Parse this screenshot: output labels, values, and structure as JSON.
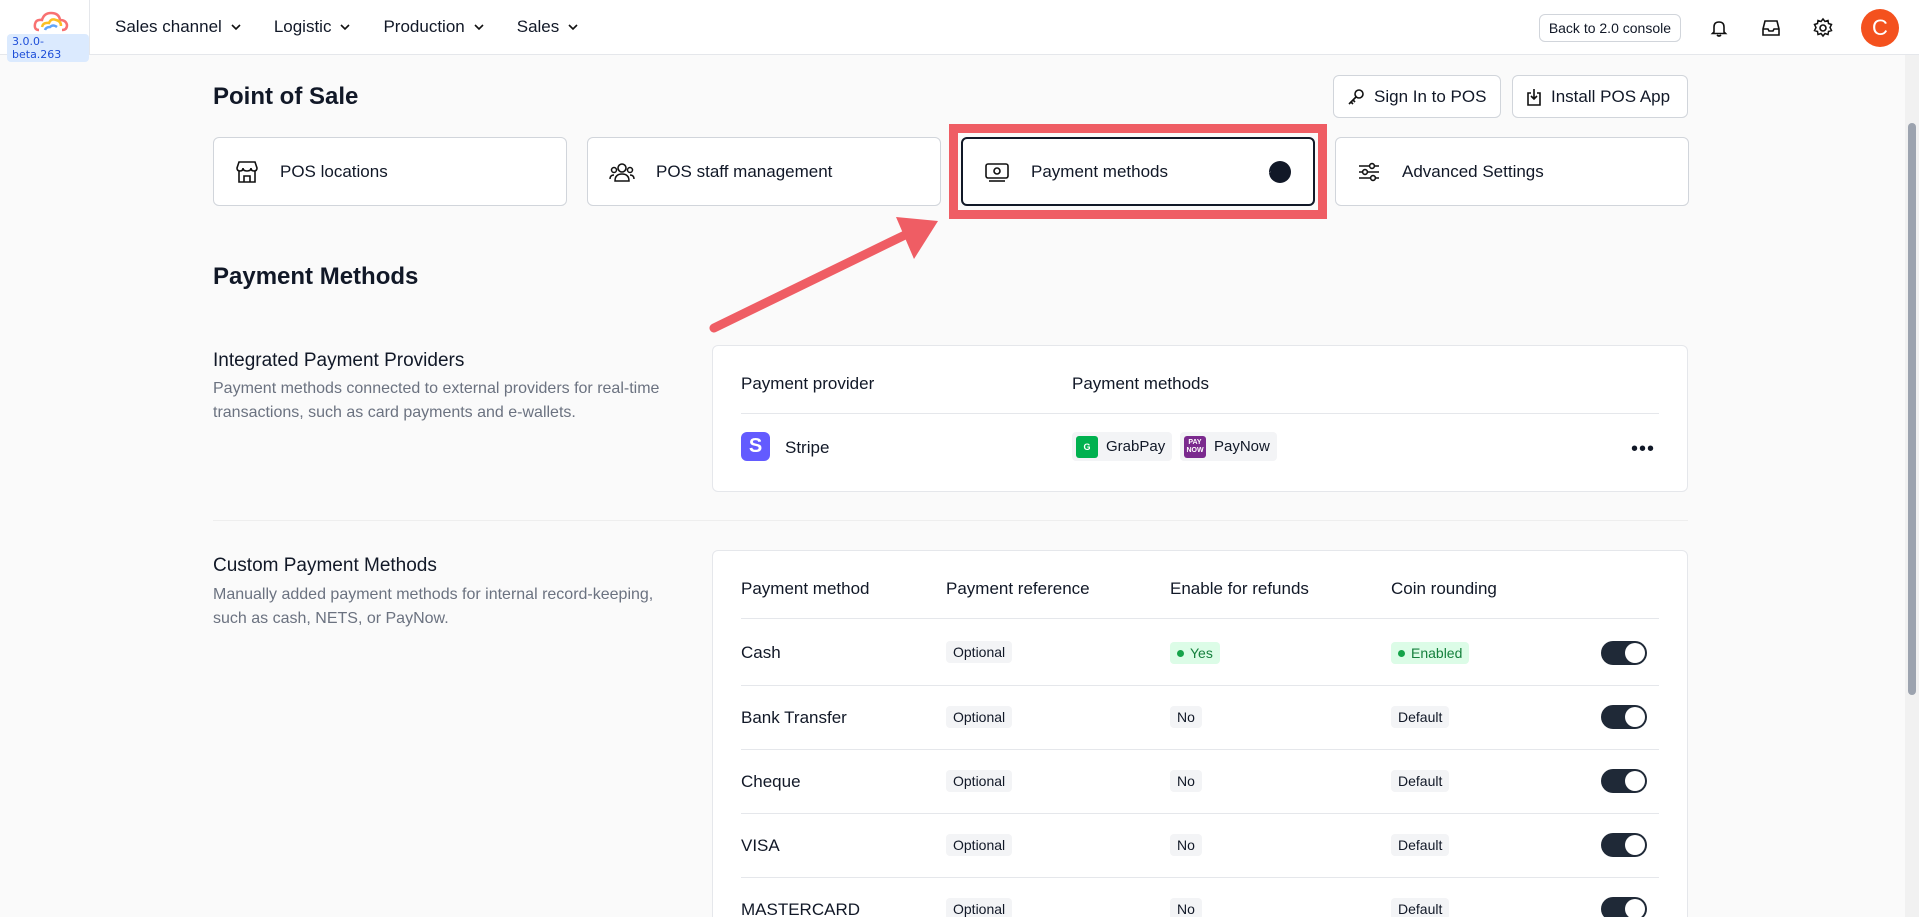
{
  "header": {
    "version": "3.0.0-beta.263",
    "nav": [
      "Sales channel",
      "Logistic",
      "Production",
      "Sales"
    ],
    "console_label": "Back to 2.0 console",
    "avatar_letter": "C"
  },
  "page": {
    "title": "Point of Sale",
    "sign_in_label": "Sign In to POS",
    "install_label": "Install POS App"
  },
  "tabs": [
    {
      "label": "POS locations",
      "icon": "store-icon"
    },
    {
      "label": "POS staff management",
      "icon": "users-icon"
    },
    {
      "label": "Payment methods",
      "icon": "cash-icon",
      "active": true
    },
    {
      "label": "Advanced Settings",
      "icon": "sliders-icon"
    }
  ],
  "section": {
    "title": "Payment Methods"
  },
  "integrated": {
    "title": "Integrated Payment Providers",
    "desc": "Payment methods connected to external providers for real-time transactions, such as card payments and e-wallets.",
    "col_provider": "Payment provider",
    "col_methods": "Payment methods",
    "provider": "Stripe",
    "methods": [
      "GrabPay",
      "PayNow"
    ]
  },
  "custom": {
    "title": "Custom Payment Methods",
    "desc": "Manually added payment methods for internal record-keeping, such as cash, NETS, or PayNow.",
    "columns": [
      "Payment method",
      "Payment reference",
      "Enable for refunds",
      "Coin rounding"
    ],
    "rows": [
      {
        "name": "Cash",
        "reference": "Optional",
        "refunds": "Yes",
        "rounding": "Enabled"
      },
      {
        "name": "Bank Transfer",
        "reference": "Optional",
        "refunds": "No",
        "rounding": "Default"
      },
      {
        "name": "Cheque",
        "reference": "Optional",
        "refunds": "No",
        "rounding": "Default"
      },
      {
        "name": "VISA",
        "reference": "Optional",
        "refunds": "No",
        "rounding": "Default"
      },
      {
        "name": "MASTERCARD",
        "reference": "Optional",
        "refunds": "No",
        "rounding": "Default"
      }
    ]
  },
  "colors": {
    "accent": "#111827",
    "highlight": "#ef5d64",
    "avatar": "#f4511e",
    "stripe": "#635bff",
    "success": "#16a34a"
  }
}
